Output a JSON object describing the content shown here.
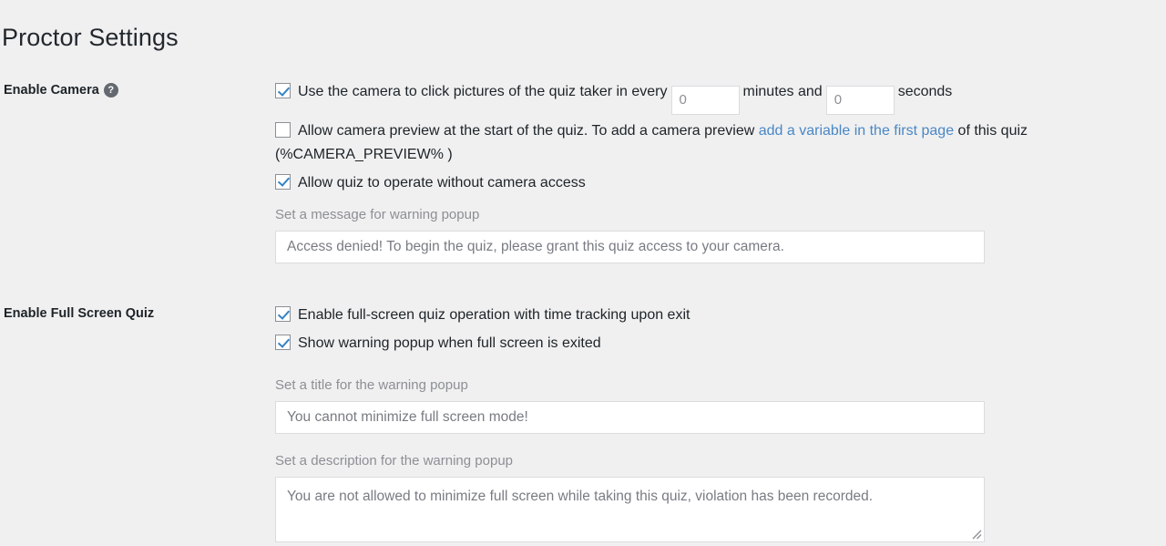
{
  "page": {
    "title": "Proctor Settings"
  },
  "camera_section": {
    "label": "Enable Camera",
    "help_icon": "question-mark-icon",
    "capture": {
      "checked": true,
      "text_before": "Use the camera to click pictures of the quiz taker in every",
      "minutes_value": "0",
      "text_middle": "minutes and",
      "seconds_value": "0",
      "text_after": "seconds"
    },
    "preview": {
      "checked": false,
      "text_before": "Allow camera preview at the start of the quiz. To add a camera preview",
      "link_text": "add a variable in the first page",
      "text_after": "of this quiz (%CAMERA_PREVIEW% )"
    },
    "without_access": {
      "checked": true,
      "text": "Allow quiz to operate without camera access"
    },
    "message_label": "Set a message for warning popup",
    "message_value": "Access denied! To begin the quiz, please grant this quiz access to your camera."
  },
  "fullscreen_section": {
    "label": "Enable Full Screen Quiz",
    "enable": {
      "checked": true,
      "text": "Enable full-screen quiz operation with time tracking upon exit"
    },
    "warning": {
      "checked": true,
      "text": "Show warning popup when full screen is exited"
    },
    "title_label": "Set a title for the warning popup",
    "title_value": "You cannot minimize full screen mode!",
    "description_label": "Set a description for the warning popup",
    "description_value": "You are not allowed to minimize full screen while taking this quiz, violation has been recorded."
  },
  "colors": {
    "background": "#f0f0f1",
    "text": "#1d2327",
    "muted": "#8c8f94",
    "link": "#4a87c4",
    "checkbox_check": "#3582c4",
    "input_border": "#dcdcde"
  }
}
